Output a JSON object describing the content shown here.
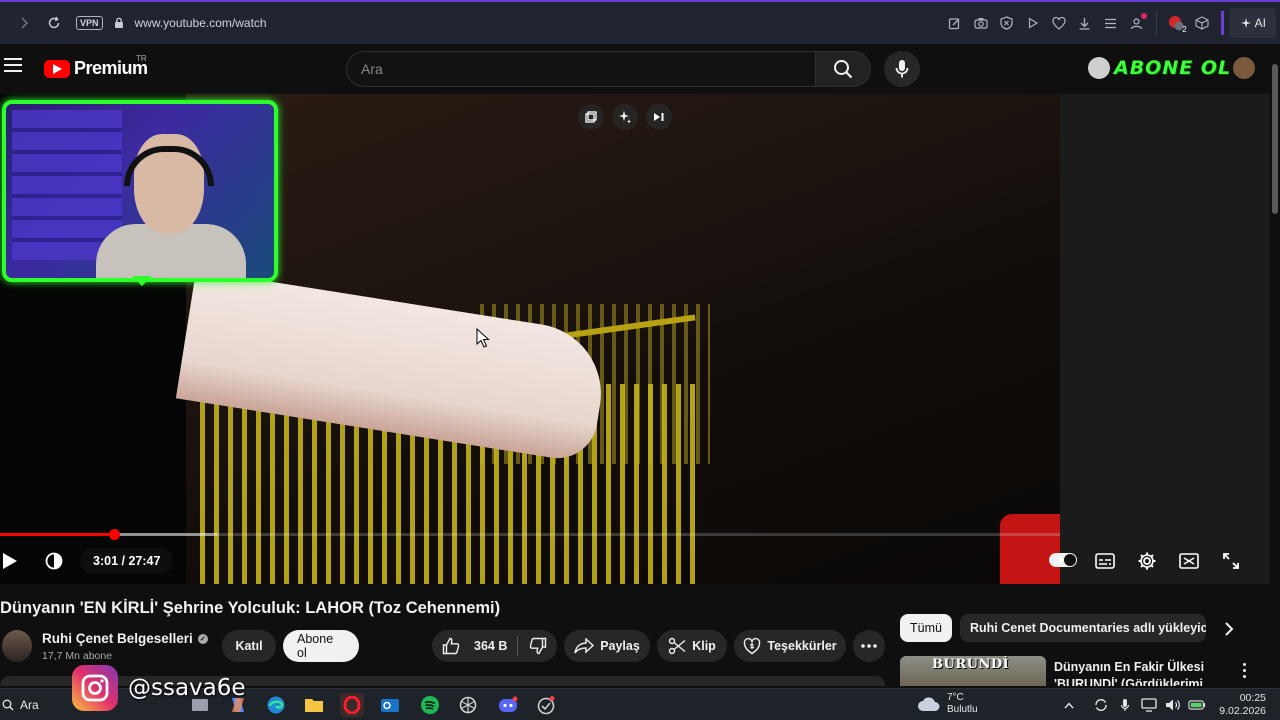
{
  "browser": {
    "vpn_label": "VPN",
    "url": "www.youtube.com/watch",
    "ai_label": "AI",
    "extension_badge": "2",
    "icons": [
      "back-icon",
      "forward-icon",
      "reload-icon",
      "lock-icon",
      "edit-icon",
      "camera-icon",
      "shield-icon",
      "play-icon",
      "heart-icon",
      "download-icon",
      "menu-icon",
      "account-icon",
      "extension-icon",
      "cube-icon",
      "ai-icon"
    ]
  },
  "youtube": {
    "logo_text": "Premium",
    "region": "TR",
    "search_placeholder": "Ara",
    "overlay_subscribe": "ABONE OL"
  },
  "player": {
    "current_time": "3:01",
    "separator": " / ",
    "duration": "27:47",
    "time_display": "3:01 / 27:47",
    "progress_fraction": 0.108,
    "buffered_fraction": 0.205,
    "icons": [
      "play-icon",
      "volume-icon",
      "autoplay-toggle",
      "subtitles-icon",
      "settings-icon",
      "theater-icon",
      "fullscreen-icon",
      "miniplayer-icon",
      "ai-sparkle-icon",
      "next-icon"
    ]
  },
  "video": {
    "title": "Dünyanın 'EN KİRLİ' Şehrine Yolculuk: LAHOR (Toz Cehennemi)",
    "channel": "Ruhi Çenet Belgeselleri",
    "subscribers": "17,7 Mn abone",
    "join_label": "Katıl",
    "subscribe_label": "Abone ol",
    "likes": "364 B",
    "share_label": "Paylaş",
    "clip_label": "Klip",
    "thanks_label": "Teşekkürler"
  },
  "sidebar": {
    "chips": [
      {
        "label": "Tümü",
        "active": true
      },
      {
        "label": "Ruhi Cenet Documentaries adlı yükleyiciden",
        "active": false
      }
    ],
    "recommendation": {
      "thumb_text": "BURUNDİ",
      "title": "Dünyanın En Fakir Ülkesi 'BURUNDİ' (Gördüklerimi Açla"
    }
  },
  "overlay": {
    "instagram_handle": "@ssava6e"
  },
  "taskbar": {
    "search_label": "Ara",
    "temperature": "7°C",
    "weather": "Bulutlu",
    "time": "00:25",
    "date": "9.02.2026"
  },
  "colors": {
    "accent_red": "#ff0000",
    "browser_accent": "#6b3fd6",
    "webcam_border": "#2dff2d",
    "abone_green": "#3cff3c"
  }
}
